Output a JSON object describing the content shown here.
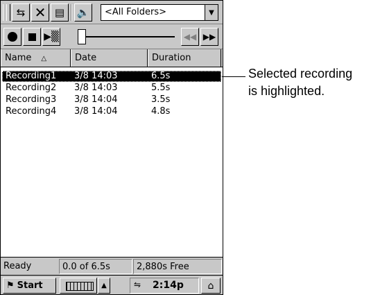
{
  "toolbar": {
    "folder": "<All Folders>",
    "icons": [
      "grip-icon",
      "switch-icon",
      "delete-icon",
      "properties-icon",
      "speaker-icon",
      "dropdown-arrow-icon"
    ]
  },
  "controls": {
    "icons": [
      "record-icon",
      "stop-icon",
      "play-icon",
      "rewind-icon",
      "fast-forward-icon"
    ]
  },
  "columns": [
    {
      "label": "Name",
      "sorted": true
    },
    {
      "label": "Date"
    },
    {
      "label": "Duration"
    }
  ],
  "recordings": [
    {
      "name": "Recording1",
      "date": "3/8 14:03",
      "duration": "6.5s",
      "selected": true
    },
    {
      "name": "Recording2",
      "date": "3/8 14:03",
      "duration": "5.5s"
    },
    {
      "name": "Recording3",
      "date": "3/8 14:04",
      "duration": "3.5s"
    },
    {
      "name": "Recording4",
      "date": "3/8 14:04",
      "duration": "4.8s"
    }
  ],
  "status": {
    "state": "Ready",
    "position": "0.0 of 6.5s",
    "free": "2,880s Free"
  },
  "taskbar": {
    "start": "Start",
    "time": "2:14p"
  },
  "callout": {
    "line1": "Selected recording",
    "line2": "is highlighted."
  }
}
